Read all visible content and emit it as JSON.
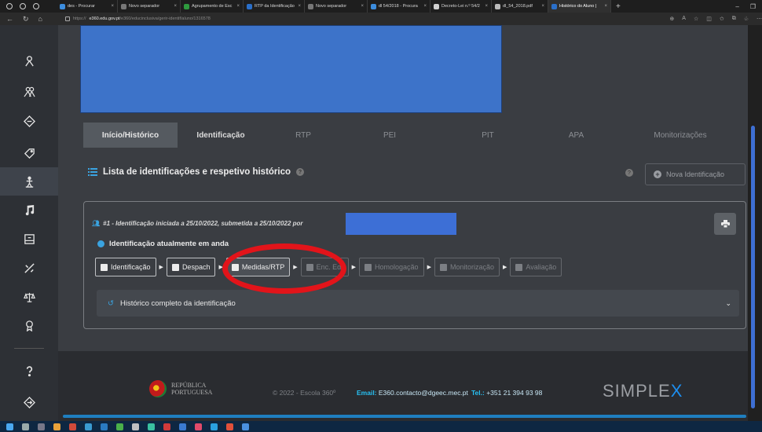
{
  "browser": {
    "tabs": [
      {
        "label": "des - Procurar",
        "color": "#3c8dde"
      },
      {
        "label": "Novo separador",
        "color": "#777777"
      },
      {
        "label": "Agrupamento de Esc",
        "color": "#2e9a3e"
      },
      {
        "label": "RTP da Identificação",
        "color": "#2a6fc9"
      },
      {
        "label": "Novo separador",
        "color": "#777777"
      },
      {
        "label": "dl 54/2018 - Procura",
        "color": "#3c8dde"
      },
      {
        "label": "Decreto-Lei n.º 54/2",
        "color": "#d0d0d0"
      },
      {
        "label": "dl_54_2018.pdf",
        "color": "#bbbbbb"
      },
      {
        "label": "Histórico do Aluno |",
        "color": "#2a6fc9"
      }
    ],
    "url_prefix": "https://",
    "url_host": "e360.edu.gov.pt",
    "url_path": "/e360/educinclusiva/gerir-identif/aluno/1316578"
  },
  "tabs": [
    {
      "label": "Início/Histórico",
      "state": "active"
    },
    {
      "label": "Identificação",
      "state": "normal"
    },
    {
      "label": "RTP",
      "state": "dim"
    },
    {
      "label": "PEI",
      "state": "dim"
    },
    {
      "label": "PIT",
      "state": "dim"
    },
    {
      "label": "APA",
      "state": "dim"
    },
    {
      "label": "Monitorizações",
      "state": "dim"
    }
  ],
  "list_title": "Lista de identificações e respetivo histórico",
  "nova_button": "Nova Identificação",
  "identification_line": "#1 - Identificação iniciada a 25/10/2022, submetida a 25/10/2022 por",
  "status_line": "Identificação atualmente em anda",
  "steps": [
    {
      "label": "Identificação",
      "state": "normal"
    },
    {
      "label": "Despach",
      "state": "normal"
    },
    {
      "label": "Medidas/RTP",
      "state": "current"
    },
    {
      "label": "Enc. Ed.",
      "state": "disabled"
    },
    {
      "label": "Homologação",
      "state": "disabled"
    },
    {
      "label": "Monitorização",
      "state": "disabled"
    },
    {
      "label": "Avaliação",
      "state": "disabled"
    }
  ],
  "history_label": "Histórico completo da identificação",
  "footer": {
    "republica_line1": "REPÚBLICA",
    "republica_line2": "PORTUGUESA",
    "copyright": "© 2022 - Escola 360º",
    "email_label": "Email:",
    "email_value": "E360.contacto@dgeec.mec.pt",
    "tel_label": "Tel.:",
    "tel_value": "+351 21 394 93 98",
    "simplex": "SIMPLE",
    "simplex_x": "X"
  },
  "colors": {
    "annotation_ellipse": "#e2141a",
    "redaction": "#3d73c9",
    "accent": "#27c0f2"
  }
}
